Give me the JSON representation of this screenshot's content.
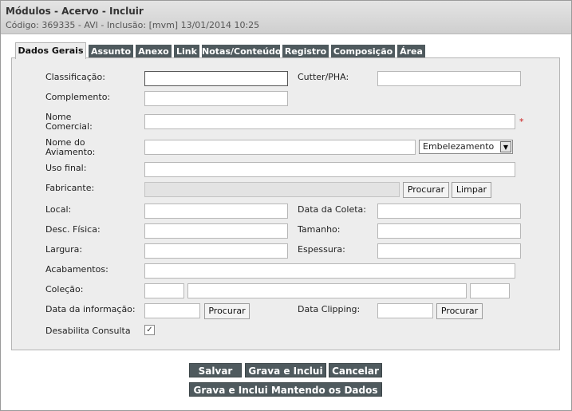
{
  "header": {
    "title": "Módulos - Acervo - Incluir",
    "subtitle": "Código: 369335 - AVI - Inclusão: [mvm] 13/01/2014 10:25"
  },
  "tabs": [
    {
      "label": "Dados Gerais"
    },
    {
      "label": "Assunto"
    },
    {
      "label": "Anexo"
    },
    {
      "label": "Link"
    },
    {
      "label": "Notas/Conteúdo"
    },
    {
      "label": "Registro"
    },
    {
      "label": "Composição"
    },
    {
      "label": "Área"
    }
  ],
  "form": {
    "classificacao": {
      "label": "Classificação:",
      "value": ""
    },
    "cutter": {
      "label": "Cutter/PHA:",
      "value": ""
    },
    "complemento": {
      "label": "Complemento:",
      "value": ""
    },
    "nome_comercial": {
      "label_line1": "Nome",
      "label_line2": "Comercial:",
      "value": "",
      "required": "*"
    },
    "nome_aviamento": {
      "label_line1": "Nome do",
      "label_line2": "Aviamento:",
      "value": "",
      "select_value": "Embelezamento",
      "select_arrow": "▼"
    },
    "uso_final": {
      "label": "Uso final:",
      "value": ""
    },
    "fabricante": {
      "label": "Fabricante:",
      "value": "",
      "search_button": "Procurar",
      "clear_button": "Limpar"
    },
    "local": {
      "label": "Local:",
      "value": ""
    },
    "data_coleta": {
      "label": "Data da Coleta:",
      "value": ""
    },
    "desc_fisica": {
      "label": "Desc. Física:",
      "value": ""
    },
    "tamanho": {
      "label": "Tamanho:",
      "value": ""
    },
    "largura": {
      "label": "Largura:",
      "value": ""
    },
    "espessura": {
      "label": "Espessura:",
      "value": ""
    },
    "acabamentos": {
      "label": "Acabamentos:",
      "value": ""
    },
    "colecao": {
      "label": "Coleção:",
      "value1": "",
      "value2": "",
      "value3": ""
    },
    "data_informacao": {
      "label": "Data da informação:",
      "value": "",
      "search_button": "Procurar"
    },
    "data_clipping": {
      "label": "Data Clipping:",
      "value": "",
      "search_button": "Procurar"
    },
    "desabilita_consulta": {
      "label": "Desabilita Consulta",
      "checked": "✓"
    }
  },
  "actions": {
    "save": "Salvar",
    "save_and_new": "Grava e Inclui",
    "cancel": "Cancelar",
    "save_and_new_keep": "Grava e Inclui Mantendo os Dados"
  }
}
